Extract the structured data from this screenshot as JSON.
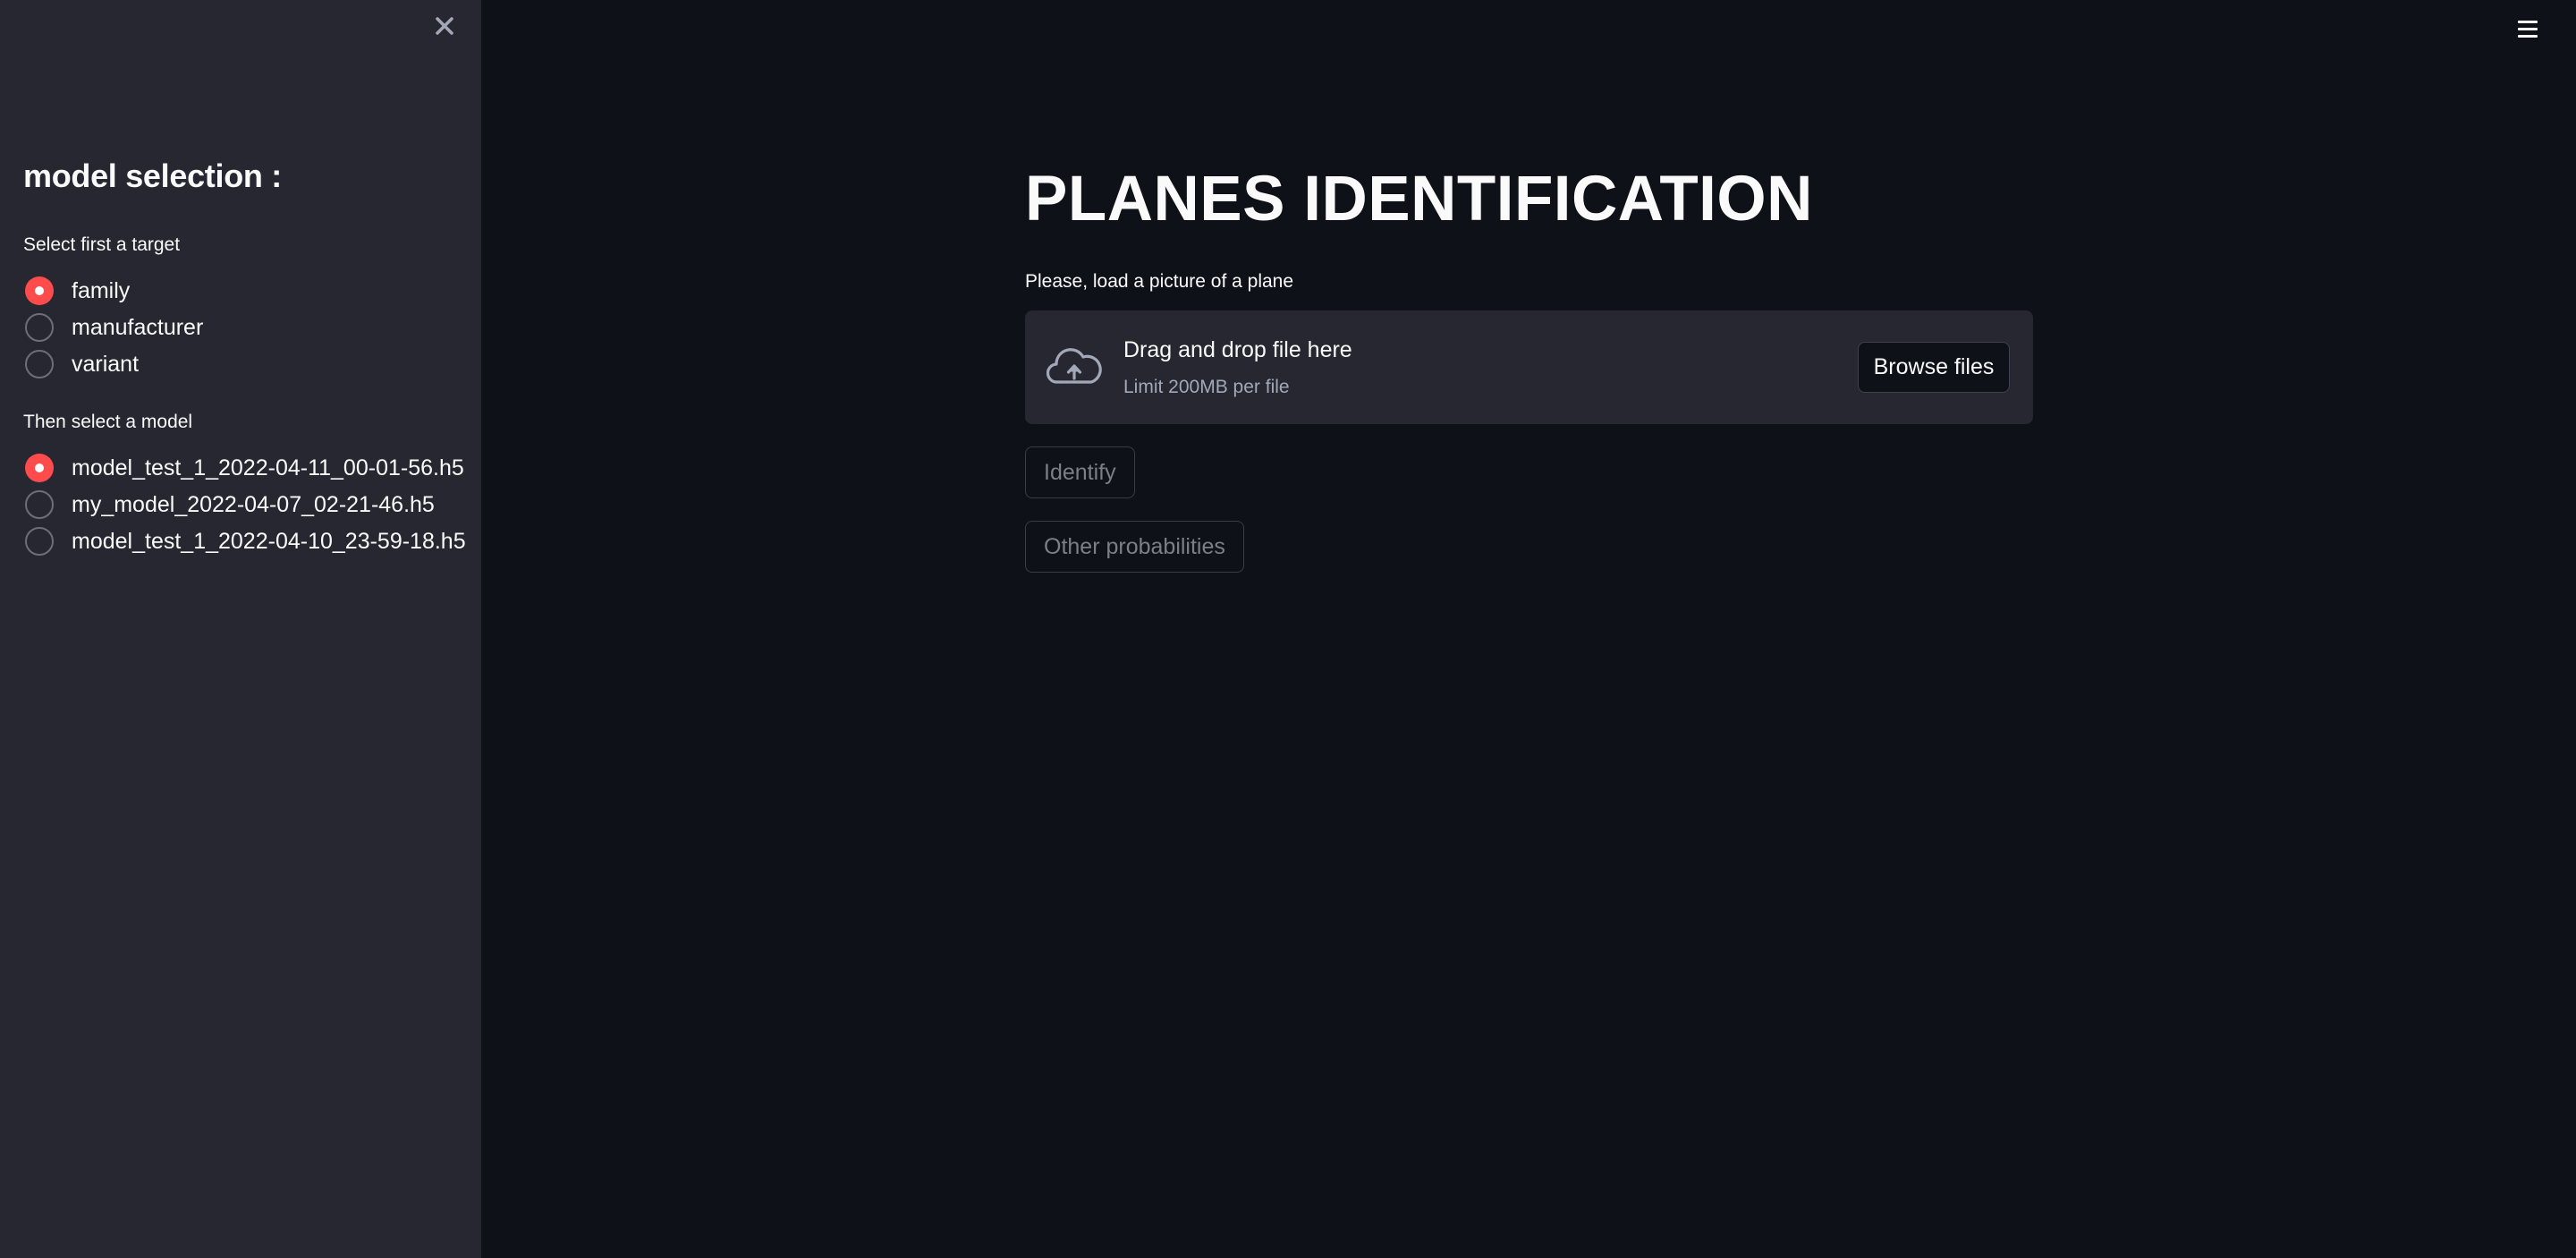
{
  "sidebar": {
    "close_icon": "close-icon",
    "heading": "model selection :",
    "target_group": {
      "label": "Select first a target",
      "options": [
        {
          "label": "family",
          "checked": true
        },
        {
          "label": "manufacturer",
          "checked": false
        },
        {
          "label": "variant",
          "checked": false
        }
      ]
    },
    "model_group": {
      "label": "Then select a model",
      "options": [
        {
          "label": "model_test_1_2022-04-11_00-01-56.h5",
          "checked": true
        },
        {
          "label": "my_model_2022-04-07_02-21-46.h5",
          "checked": false
        },
        {
          "label": "model_test_1_2022-04-10_23-59-18.h5",
          "checked": false
        }
      ]
    }
  },
  "header": {
    "menu_icon": "hamburger-menu-icon"
  },
  "main": {
    "title": "PLANES IDENTIFICATION",
    "uploader": {
      "label": "Please, load a picture of a plane",
      "drop_title": "Drag and drop file here",
      "drop_limit": "Limit 200MB per file",
      "browse_label": "Browse files",
      "icon": "cloud-upload-icon"
    },
    "identify_label": "Identify",
    "other_prob_label": "Other probabilities"
  },
  "colors": {
    "background": "#0e1117",
    "sidebar": "#262730",
    "accent": "#ff4b4b",
    "text": "#fafafa",
    "muted_text": "#a3a8b8"
  }
}
